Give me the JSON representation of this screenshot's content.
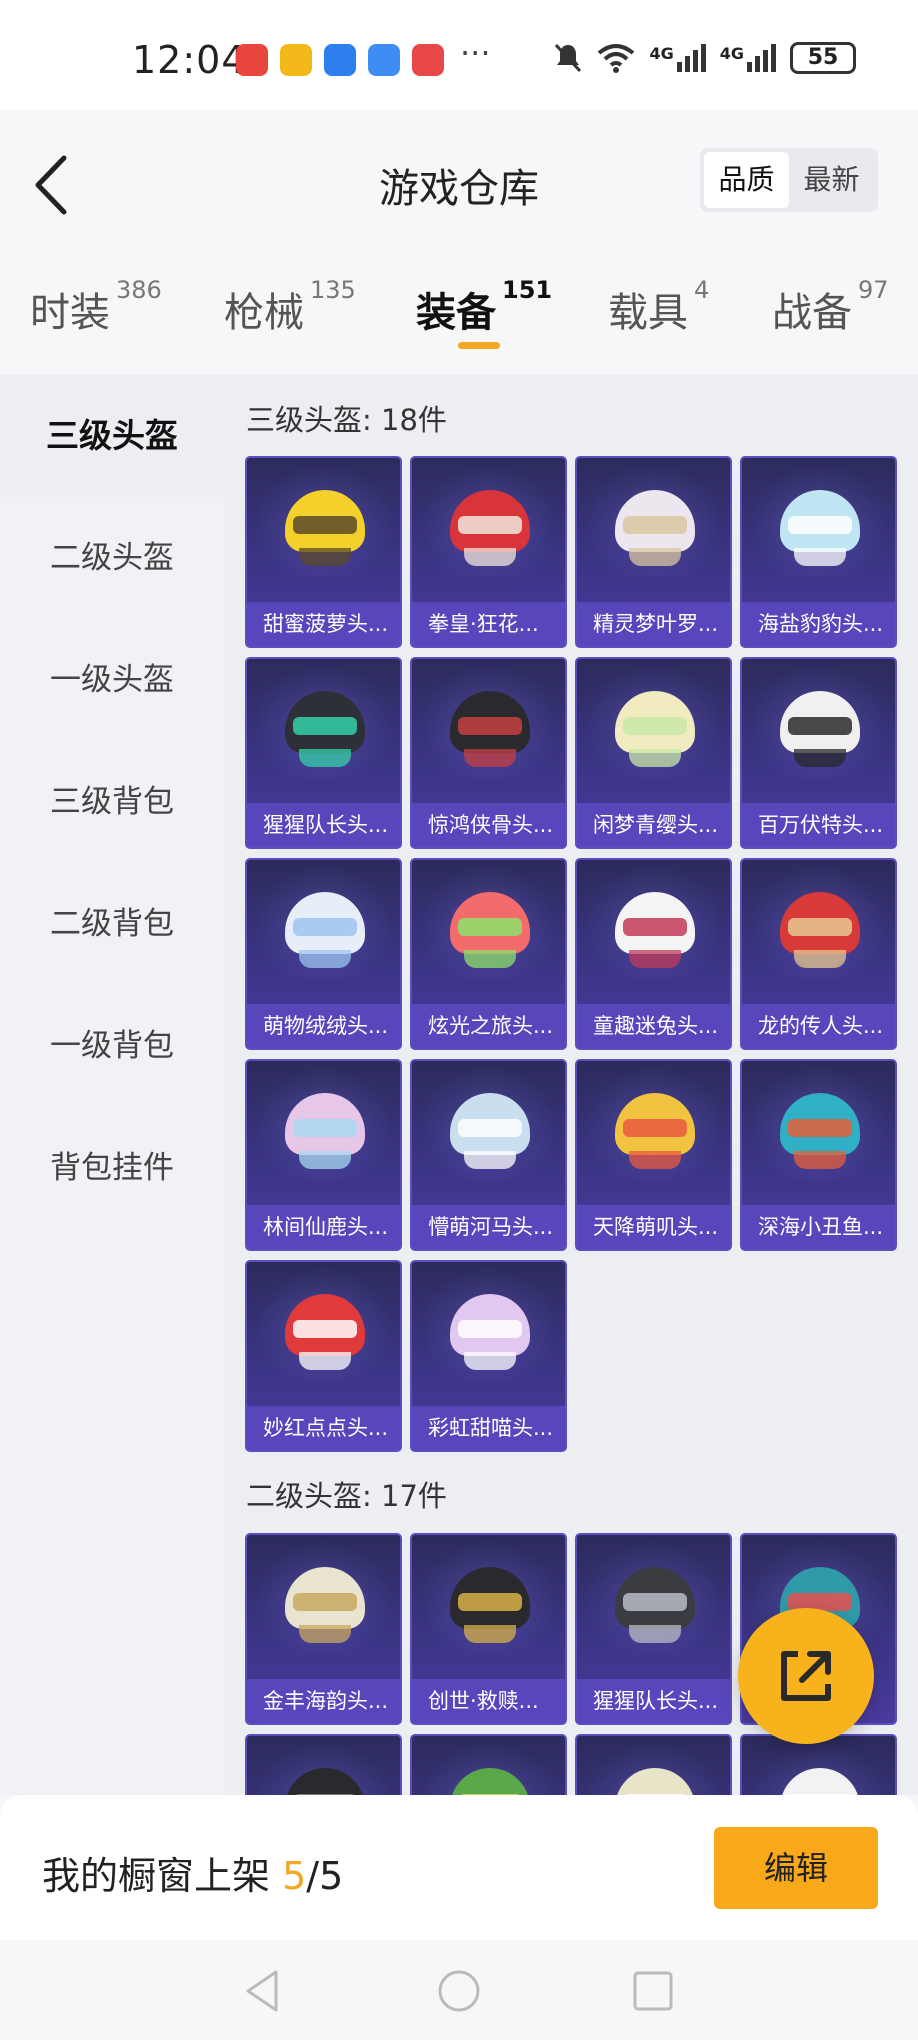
{
  "status_bar": {
    "time": "12:04",
    "more": "···",
    "battery": "55",
    "signal_1": "4G",
    "signal_2": "4G",
    "app_icons": [
      "huawei-store-icon",
      "game-icon",
      "assistant-icon",
      "cloud-icon",
      "book-icon"
    ],
    "status_icons": [
      "mute-icon",
      "wifi-icon",
      "cellular-signal-icon",
      "cellular-signal-icon"
    ]
  },
  "header": {
    "title": "游戏仓库",
    "sort_options": [
      "品质",
      "最新"
    ],
    "sort_selected": "品质"
  },
  "tabs": [
    {
      "label": "时装",
      "count": "386"
    },
    {
      "label": "枪械",
      "count": "135"
    },
    {
      "label": "装备",
      "count": "151"
    },
    {
      "label": "载具",
      "count": "4"
    },
    {
      "label": "战备",
      "count": "97"
    }
  ],
  "active_tab": "装备",
  "sidebar": {
    "items": [
      "三级头盔",
      "二级头盔",
      "一级头盔",
      "三级背包",
      "二级背包",
      "一级背包",
      "背包挂件"
    ],
    "active": "三级头盔"
  },
  "sections": [
    {
      "title": "三级头盔: 18件",
      "items": [
        {
          "name": "甜蜜菠萝头...",
          "color": "#f3d12a",
          "accent": "#5b4a2a"
        },
        {
          "name": "拳皇·狂花...",
          "color": "#d8343a",
          "accent": "#f1e7dc"
        },
        {
          "name": "精灵梦叶罗...",
          "color": "#eee6ef",
          "accent": "#d8c7a0"
        },
        {
          "name": "海盐豹豹头...",
          "color": "#bfe6f2",
          "accent": "#ffffff"
        },
        {
          "name": "猩猩队长头...",
          "color": "#2d3036",
          "accent": "#35d0a8"
        },
        {
          "name": "惊鸿侠骨头...",
          "color": "#2a2a2e",
          "accent": "#c44040"
        },
        {
          "name": "闲梦青缨头...",
          "color": "#f0ecc0",
          "accent": "#c9e8a8"
        },
        {
          "name": "百万伏特头...",
          "color": "#f0f0f0",
          "accent": "#2a2a2e"
        },
        {
          "name": "萌物绒绒头...",
          "color": "#e8eef8",
          "accent": "#9cc6f0"
        },
        {
          "name": "炫光之旅头...",
          "color": "#f46b6b",
          "accent": "#8de06a"
        },
        {
          "name": "童趣迷兔头...",
          "color": "#f4f4f4",
          "accent": "#c23a5b"
        },
        {
          "name": "龙的传人头...",
          "color": "#d83a3a",
          "accent": "#e8c890"
        },
        {
          "name": "林间仙鹿头...",
          "color": "#e7c7e8",
          "accent": "#a8d8f0"
        },
        {
          "name": "懵萌河马头...",
          "color": "#c9dff0",
          "accent": "#ffffff"
        },
        {
          "name": "天降萌叽头...",
          "color": "#f2c340",
          "accent": "#e85b40"
        },
        {
          "name": "深海小丑鱼...",
          "color": "#2fb0c4",
          "accent": "#e8603a"
        },
        {
          "name": "妙红点点头...",
          "color": "#e03a3a",
          "accent": "#ffffff"
        },
        {
          "name": "彩虹甜喵头...",
          "color": "#e2c8f0",
          "accent": "#ffffff"
        }
      ]
    },
    {
      "title": "二级头盔: 17件",
      "items": [
        {
          "name": "金丰海韵头...",
          "color": "#e8e4d0",
          "accent": "#c8a860"
        },
        {
          "name": "创世·救赎...",
          "color": "#2a2a2e",
          "accent": "#d8b048"
        },
        {
          "name": "猩猩队长头...",
          "color": "#3a3c42",
          "accent": "#b8bcc4"
        },
        {
          "name": "",
          "color": "#2f9aa8",
          "accent": "#e85050"
        },
        {
          "name": "",
          "color": "#2a2a2e",
          "accent": "#888888"
        },
        {
          "name": "",
          "color": "#5aa84a",
          "accent": "#e8d060"
        },
        {
          "name": "",
          "color": "#e8e4c8",
          "accent": "#ffffff"
        },
        {
          "name": "",
          "color": "#f2f2f2",
          "accent": "#ffffff"
        }
      ]
    }
  ],
  "bottom_bar": {
    "label": "我的橱窗上架 ",
    "count_current": "5",
    "count_total": "/5",
    "edit_button": "编辑"
  },
  "fab_icon": "share-icon",
  "nav_icons": [
    "back-triangle-icon",
    "home-circle-icon",
    "recents-square-icon"
  ]
}
